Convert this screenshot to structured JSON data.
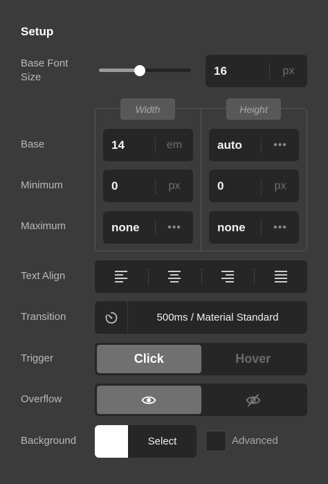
{
  "section": {
    "title": "Setup"
  },
  "base_font_size": {
    "label": "Base Font Size",
    "slider_fraction": 0.44,
    "value": "16",
    "unit": "px"
  },
  "dimensions": {
    "width_label": "Width",
    "height_label": "Height",
    "rows": [
      {
        "label": "Base",
        "width_value": "14",
        "width_unit": "em",
        "height_value": "auto",
        "height_unit": "•••"
      },
      {
        "label": "Minimum",
        "width_value": "0",
        "width_unit": "px",
        "height_value": "0",
        "height_unit": "px"
      },
      {
        "label": "Maximum",
        "width_value": "none",
        "width_unit": "•••",
        "height_value": "none",
        "height_unit": "•••"
      }
    ]
  },
  "text_align": {
    "label": "Text Align",
    "options": [
      "align-left-icon",
      "align-center-icon",
      "align-right-icon",
      "align-justify-icon"
    ]
  },
  "transition": {
    "label": "Transition",
    "value": "500ms / Material Standard",
    "icon": "timer-icon"
  },
  "trigger": {
    "label": "Trigger",
    "options": [
      "Click",
      "Hover"
    ],
    "selected": "Click"
  },
  "overflow": {
    "label": "Overflow",
    "options": [
      "eye-icon",
      "eye-off-icon"
    ],
    "selected": "eye-icon"
  },
  "background": {
    "label": "Background",
    "swatch_color": "#ffffff",
    "select_label": "Select",
    "advanced_label": "Advanced"
  },
  "colors": {
    "panel": "#3b3b3b",
    "field": "#262626",
    "active_segment": "#707070"
  }
}
